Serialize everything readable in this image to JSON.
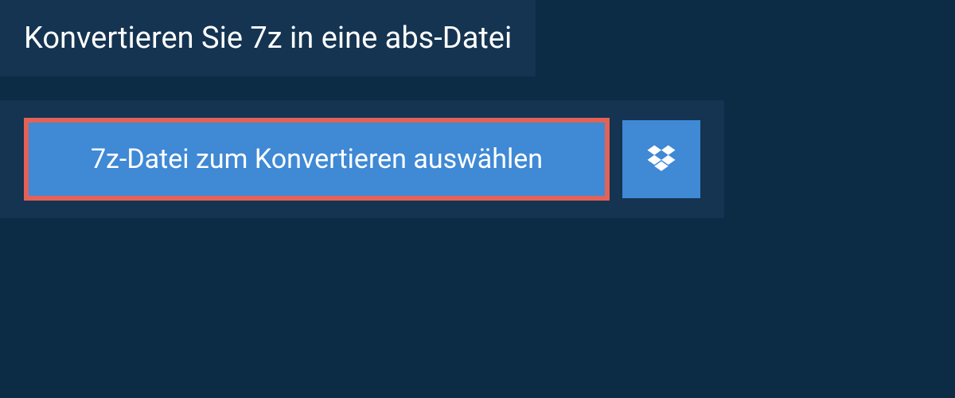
{
  "header": {
    "title": "Konvertieren Sie 7z in eine abs-Datei"
  },
  "main": {
    "select_button_label": "7z-Datei zum Konvertieren auswählen"
  },
  "colors": {
    "background": "#0c2b45",
    "panel": "#143451",
    "button": "#3f89d5",
    "highlight_border": "#e36257"
  }
}
